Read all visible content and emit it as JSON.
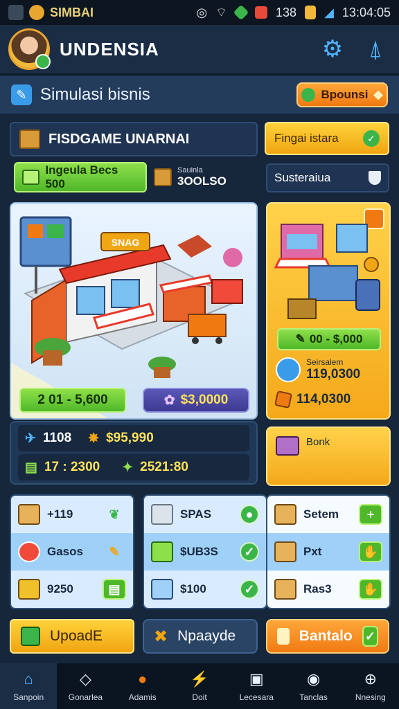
{
  "status_bar": {
    "app_label": "SIMBAI",
    "counter": "138",
    "clock": "13:04:05"
  },
  "header": {
    "player_name": "UNDENSIA"
  },
  "title_bar": {
    "title": "Simulasi bisnis",
    "bonus_label": "Bpounsi"
  },
  "store": {
    "name": "FISDGAME UNARNAI",
    "status_label": "Fingai istara",
    "sustain_label": "Susteraiua"
  },
  "price_row": {
    "price_label": "Ingeula Becs 500",
    "coins_small_label": "Sauinla",
    "coins_value": "3OOLSO"
  },
  "shop": {
    "sign": "SNAG",
    "price_a": "2 01 - 5,600",
    "price_b": "$3,0000"
  },
  "stall": {
    "price": "00 - $,000",
    "label": "Seirsalem",
    "value_a": "119,0300",
    "value_b": "114,0300"
  },
  "stats": {
    "line1_a": "1108",
    "line1_b": "$95,990",
    "line2_a": "17 : 2300",
    "line2_b": "2521:80"
  },
  "bank": {
    "label": "Bonk"
  },
  "inventory": {
    "col1": [
      {
        "label": "+119"
      },
      {
        "label": "Gasos"
      },
      {
        "label": "9250"
      }
    ],
    "col2": [
      {
        "label": "SPAS"
      },
      {
        "label": "$UB3S"
      },
      {
        "label": "$100"
      }
    ],
    "col3": [
      {
        "label": "Setem"
      },
      {
        "label": "Pxt"
      },
      {
        "label": "Ras3"
      }
    ]
  },
  "actions": {
    "upgrade_a": "UpoadE",
    "upgrade_b": "Npaayde",
    "bantalo": "Bantalo"
  },
  "nav": [
    {
      "label": "Sanpoin"
    },
    {
      "label": "Gonarlea"
    },
    {
      "label": "Adamis"
    },
    {
      "label": "Doit"
    },
    {
      "label": "Lecesara"
    },
    {
      "label": "Tanclas"
    },
    {
      "label": "Nnesing"
    }
  ],
  "colors": {
    "accent_orange": "#f07a12",
    "accent_green": "#4fb82a",
    "accent_yellow": "#f5a81a",
    "bg_navy": "#16263b"
  }
}
